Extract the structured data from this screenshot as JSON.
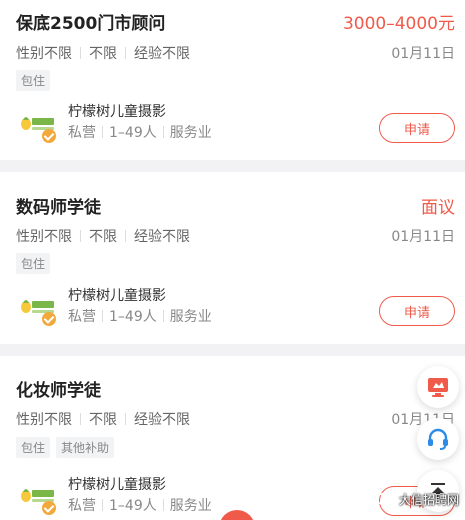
{
  "jobs": [
    {
      "title": "保底2500门市顾问",
      "salary": "3000–4000元",
      "gender": "性别不限",
      "education": "不限",
      "experience": "经验不限",
      "date": "01月11日",
      "tags": [
        "包住"
      ],
      "company": "柠檬树儿童摄影",
      "company_type": "私营",
      "company_size": "1–49人",
      "industry": "服务业",
      "apply_label": "申请"
    },
    {
      "title": "数码师学徒",
      "salary": "面议",
      "gender": "性别不限",
      "education": "不限",
      "experience": "经验不限",
      "date": "01月11日",
      "tags": [
        "包住"
      ],
      "company": "柠檬树儿童摄影",
      "company_type": "私营",
      "company_size": "1–49人",
      "industry": "服务业",
      "apply_label": "申请"
    },
    {
      "title": "化妆师学徒",
      "salary": "",
      "gender": "性别不限",
      "education": "不限",
      "experience": "经验不限",
      "date": "01月11日",
      "tags": [
        "包住",
        "其他补助"
      ],
      "company": "柠檬树儿童摄影",
      "company_type": "私营",
      "company_size": "1–49人",
      "industry": "服务业",
      "apply_label": "申请"
    }
  ],
  "watermark": "大信招聘网",
  "colors": {
    "accent": "#f05a4a",
    "badge": "#f2a93b",
    "logo_green": "#7ab648",
    "icon_blue": "#2e8ce6"
  },
  "icons": {
    "fab1": "monitor-icon",
    "fab2": "headset-icon",
    "fab3": "scroll-top-icon",
    "verified": "verified-badge-icon"
  }
}
